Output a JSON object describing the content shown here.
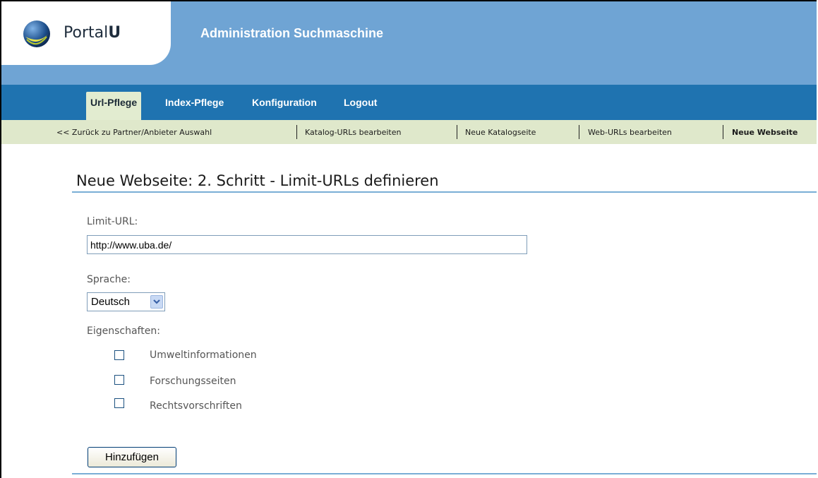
{
  "header": {
    "logo_text_regular": "Portal",
    "logo_text_bold": "U",
    "app_title": "Administration Suchmaschine"
  },
  "main_nav": {
    "items": [
      "Url-Pflege",
      "Index-Pflege",
      "Konfiguration",
      "Logout"
    ],
    "active": "Url-Pflege"
  },
  "sub_nav": {
    "items": [
      "<< Zurück zu Partner/Anbieter Auswahl",
      "Katalog-URLs bearbeiten",
      "Neue Katalogseite",
      "Web-URLs bearbeiten",
      "Neue Webseite"
    ],
    "current": "Neue Webseite"
  },
  "page": {
    "title": "Neue Webseite: 2. Schritt - Limit-URLs definieren"
  },
  "form": {
    "limit_url_label": "Limit-URL:",
    "limit_url_value": "http://www.uba.de/",
    "language_label": "Sprache:",
    "language_value": "Deutsch",
    "properties_label": "Eigenschaften:",
    "properties": [
      {
        "label": "Umweltinformationen",
        "checked": false
      },
      {
        "label": "Forschungsseiten",
        "checked": false
      },
      {
        "label": "Rechtsvorschriften",
        "checked": false
      }
    ],
    "submit_label": "Hinzufügen"
  },
  "colors": {
    "header_bg": "#6fa4d4",
    "nav_bg": "#1f73b0",
    "subnav_bg": "#dfe8cb",
    "rule": "#7aaed6"
  }
}
